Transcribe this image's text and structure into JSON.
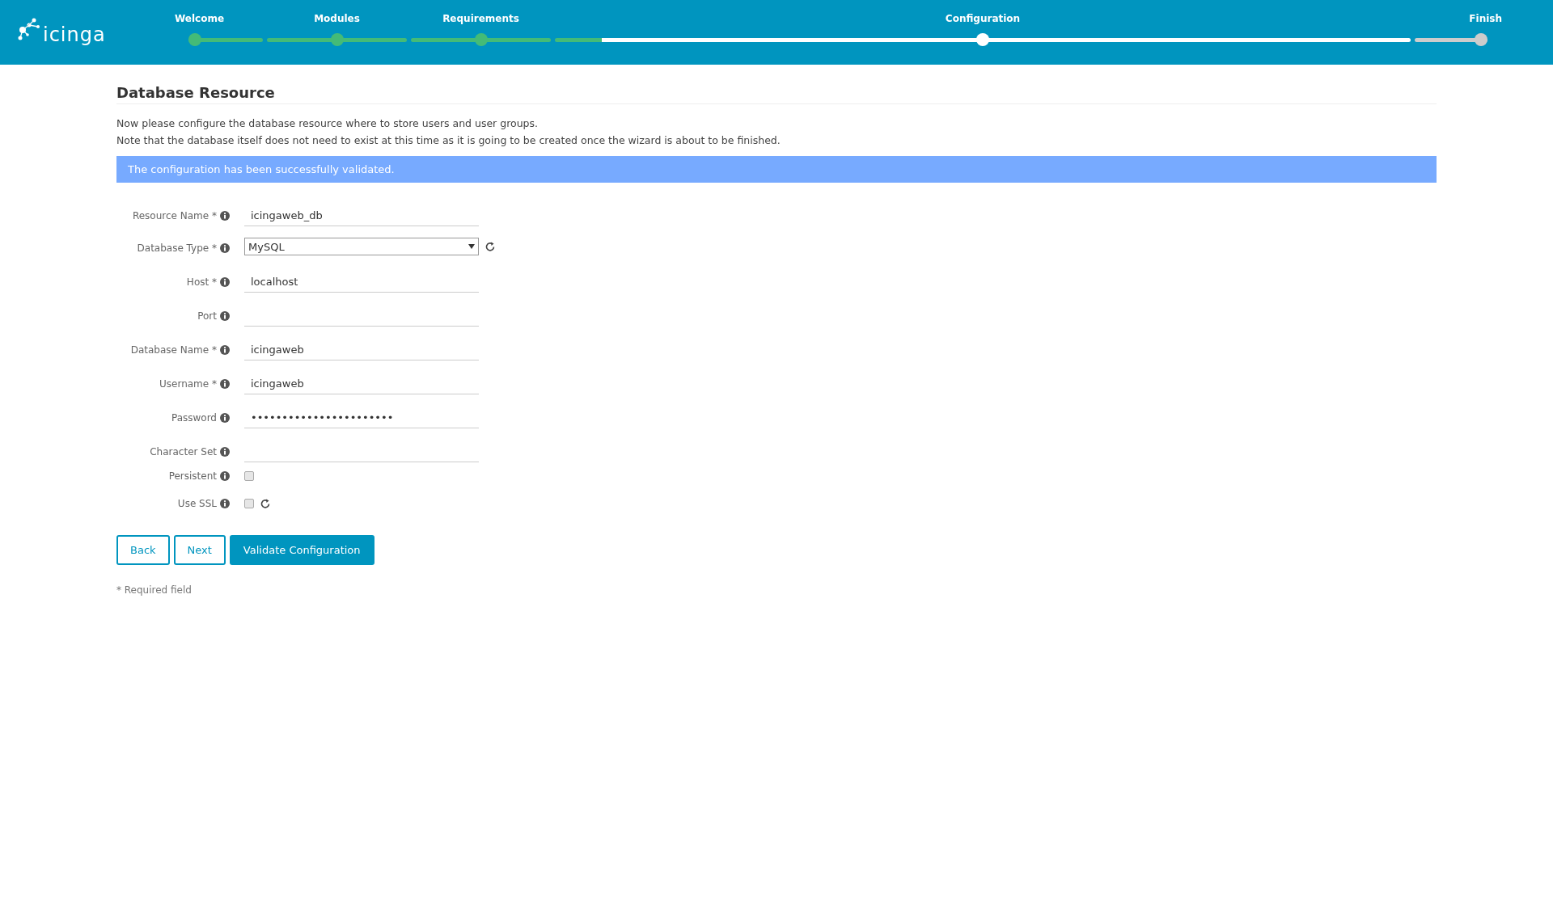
{
  "header": {
    "logo": "icinga",
    "steps": [
      {
        "label": "Welcome",
        "selected": false,
        "completed": true
      },
      {
        "label": "Modules",
        "selected": false,
        "completed": true
      },
      {
        "label": "Requirements",
        "selected": false,
        "completed": true
      },
      {
        "label": "Configuration",
        "selected": true,
        "completed": false
      },
      {
        "label": "Finish",
        "selected": false,
        "completed": false
      }
    ]
  },
  "page": {
    "title": "Database Resource",
    "description": [
      "Now please configure the database resource where to store users and user groups.",
      "Note that the database itself does not need to exist at this time as it is going to be created once the wizard is about to be finished."
    ],
    "alert": "The configuration has been successfully validated.",
    "fields": [
      {
        "kind": "text",
        "label": "Resource Name *",
        "value": "icingaweb_db"
      },
      {
        "kind": "select",
        "label": "Database Type *",
        "value": "MySQL",
        "refresh": true
      },
      {
        "kind": "text",
        "label": "Host *",
        "value": "localhost"
      },
      {
        "kind": "text",
        "label": "Port"
      },
      {
        "kind": "text",
        "label": "Database Name *",
        "value": "icingaweb"
      },
      {
        "kind": "text",
        "label": "Username *",
        "value": "icingaweb"
      },
      {
        "kind": "password",
        "label": "Password",
        "value": "•••••••••••••••••••••••"
      },
      {
        "kind": "text",
        "label": "Character Set"
      },
      {
        "kind": "checkbox",
        "label": "Persistent",
        "checked": false
      },
      {
        "kind": "checkbox",
        "label": "Use SSL",
        "checked": false,
        "refresh": true
      }
    ],
    "buttons": [
      {
        "label": "Back",
        "kind": "secondary"
      },
      {
        "label": "Next",
        "kind": "secondary"
      },
      {
        "label": "Validate Configuration",
        "kind": "primary"
      }
    ],
    "footnote": "* Required field"
  }
}
